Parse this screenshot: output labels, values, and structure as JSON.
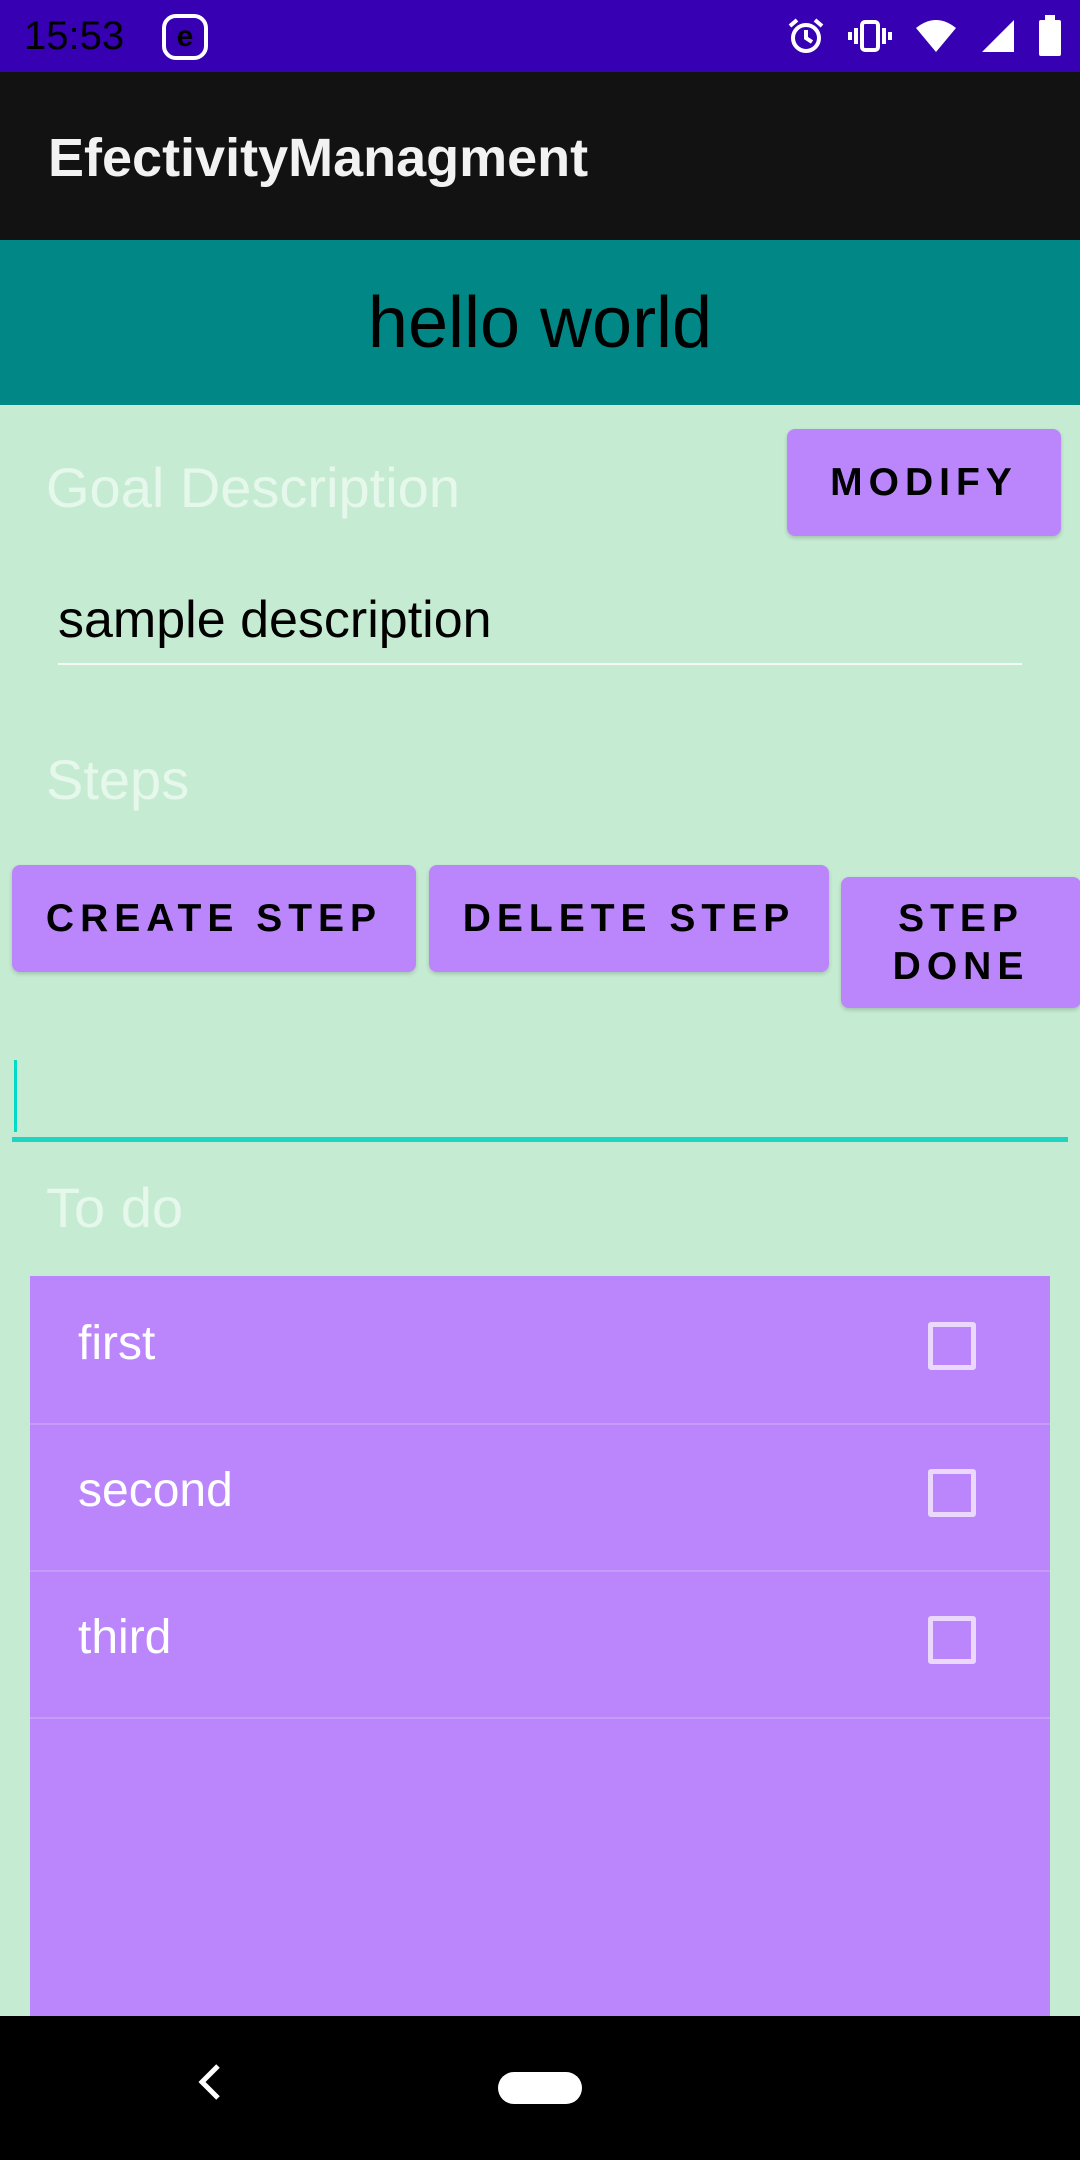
{
  "status_bar": {
    "time": "15:53",
    "app_badge": "e"
  },
  "app_bar": {
    "title": "EfectivityManagment"
  },
  "header": {
    "text": "hello world"
  },
  "goal": {
    "label": "Goal Description",
    "modify_label": "MODIFY",
    "description_value": "sample description"
  },
  "steps": {
    "label": "Steps",
    "create_label": "CREATE STEP",
    "delete_label": "DELETE STEP",
    "done_label": "STEP DONE",
    "input_value": ""
  },
  "todo": {
    "label": "To do",
    "items": [
      {
        "label": "first",
        "checked": false
      },
      {
        "label": "second",
        "checked": false
      },
      {
        "label": "third",
        "checked": false
      }
    ]
  },
  "colors": {
    "status_bar": "#3700b3",
    "app_bar": "#121212",
    "header": "#018786",
    "background": "#c5ecd2",
    "accent_purple": "#bb86fc",
    "input_accent": "#03dac5"
  }
}
